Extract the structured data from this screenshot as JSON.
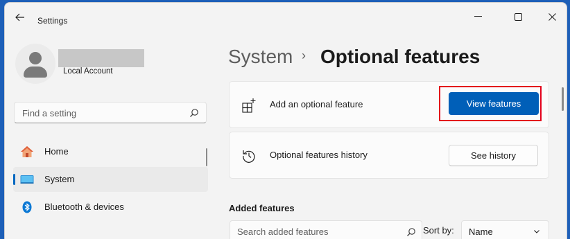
{
  "window": {
    "title": "Settings"
  },
  "account": {
    "type": "Local Account"
  },
  "search": {
    "placeholder": "Find a setting"
  },
  "nav": {
    "items": [
      {
        "label": "Home",
        "icon": "home-icon",
        "selected": false
      },
      {
        "label": "System",
        "icon": "system-display-icon",
        "selected": true
      },
      {
        "label": "Bluetooth & devices",
        "icon": "bluetooth-icon",
        "selected": false
      }
    ]
  },
  "breadcrumb": {
    "parent": "System",
    "separator": "›",
    "current": "Optional features"
  },
  "cards": {
    "add": {
      "label": "Add an optional feature",
      "button": "View features",
      "icon": "add-apps-icon"
    },
    "history": {
      "label": "Optional features history",
      "button": "See history",
      "icon": "history-icon"
    }
  },
  "added": {
    "heading": "Added features",
    "search_placeholder": "Search added features",
    "sort_label": "Sort by:",
    "sort_value": "Name"
  },
  "colors": {
    "accent": "#005fb8",
    "highlight": "#e3001b",
    "background": "#f3f3f3"
  }
}
